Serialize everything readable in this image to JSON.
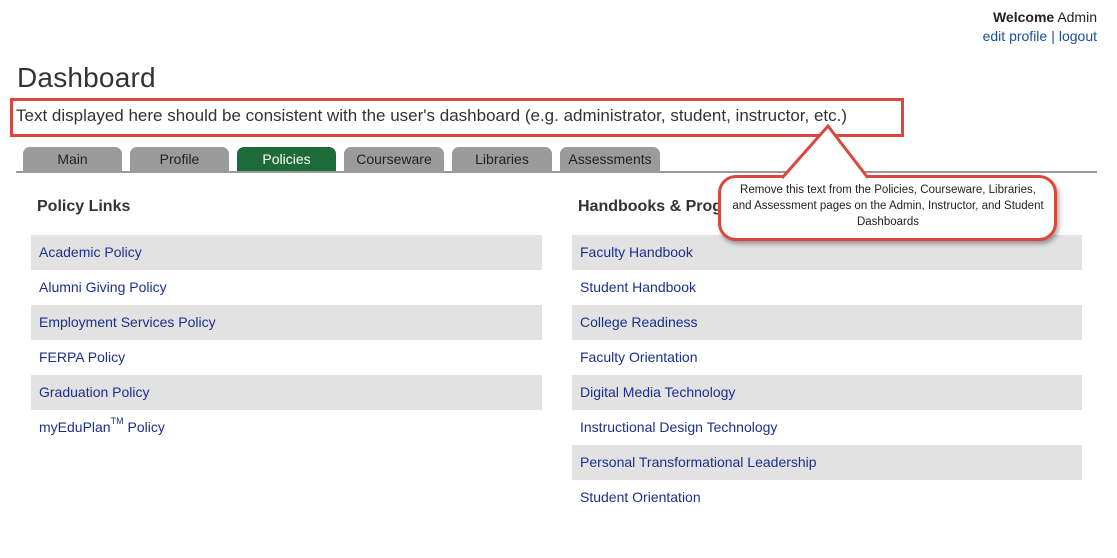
{
  "user": {
    "welcome_label": "Welcome",
    "name": "Admin",
    "edit_profile": "edit profile",
    "separator": "|",
    "logout": "logout"
  },
  "page_title": "Dashboard",
  "subtext": "Text displayed here should be consistent with the user's dashboard (e.g. administrator, student, instructor, etc.)",
  "tabs": [
    {
      "label": "Main"
    },
    {
      "label": "Profile"
    },
    {
      "label": "Policies",
      "active": true
    },
    {
      "label": "Courseware"
    },
    {
      "label": "Libraries"
    },
    {
      "label": "Assessments"
    }
  ],
  "policy_links": {
    "heading": "Policy Links",
    "items": [
      "Academic Policy",
      "Alumni Giving Policy",
      "Employment Services Policy",
      "FERPA Policy",
      "Graduation Policy",
      {
        "prefix": "myEduPlan",
        "sup": "TM",
        "suffix": " Policy"
      }
    ]
  },
  "handbooks": {
    "heading": "Handbooks & Programs",
    "items": [
      "Faculty Handbook",
      "Student Handbook",
      "College Readiness",
      "Faculty Orientation",
      "Digital Media Technology",
      "Instructional Design Technology",
      "Personal Transformational Leadership",
      "Student Orientation"
    ]
  },
  "callout": {
    "text": "Remove this text from the Policies, Courseware, Libraries, and Assessment pages on the Admin, Instructor, and Student Dashboards"
  },
  "colors": {
    "active_tab": "#1e6b3a",
    "inactive_tab": "#9b9b9b",
    "annotation_red": "#d9473f",
    "link": "#1c2f8f",
    "row_shade": "#e2e2e2"
  }
}
